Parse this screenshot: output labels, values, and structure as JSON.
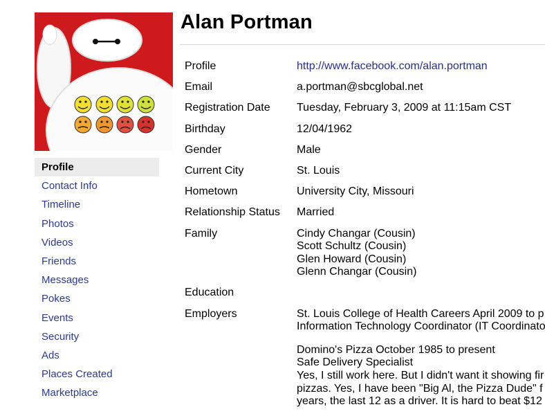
{
  "profile_name": "Alan Portman",
  "sidebar": {
    "items": [
      {
        "label": "Profile",
        "active": true
      },
      {
        "label": "Contact Info"
      },
      {
        "label": "Timeline"
      },
      {
        "label": "Photos"
      },
      {
        "label": "Videos"
      },
      {
        "label": "Friends"
      },
      {
        "label": "Messages"
      },
      {
        "label": "Pokes"
      },
      {
        "label": "Events"
      },
      {
        "label": "Security"
      },
      {
        "label": "Ads"
      },
      {
        "label": "Places Created"
      },
      {
        "label": "Marketplace"
      }
    ]
  },
  "details": {
    "profile": {
      "label": "Profile",
      "value": "http://www.facebook.com/alan.portman"
    },
    "email": {
      "label": "Email",
      "value": "a.portman@sbcglobal.net"
    },
    "registration": {
      "label": "Registration Date",
      "value": "Tuesday, February 3, 2009 at 11:15am CST"
    },
    "birthday": {
      "label": "Birthday",
      "value": "12/04/1962"
    },
    "gender": {
      "label": "Gender",
      "value": "Male"
    },
    "current_city": {
      "label": "Current City",
      "value": "St. Louis"
    },
    "hometown": {
      "label": "Hometown",
      "value": "University City, Missouri"
    },
    "relationship": {
      "label": "Relationship Status",
      "value": "Married"
    },
    "family": {
      "label": "Family",
      "members": [
        "Cindy Changar (Cousin)",
        "Scott Schultz (Cousin)",
        "Glen Howard (Cousin)",
        "Glenn Changar (Cousin)"
      ]
    },
    "education": {
      "label": "Education"
    },
    "employers": {
      "label": "Employers",
      "lines": [
        "St. Louis College of Health Careers April 2009 to p",
        "Information Technology Coordinator (IT Coordinato",
        "",
        "Domino's Pizza October 1985 to present",
        "Safe Delivery Specialist",
        "Yes, I still work here. But I didn't want it showing fir",
        "pizzas. Yes, I have been \"Big Al, the Pizza Dude\" f",
        "years, the last 12 as a driver. It is hard to beat $12"
      ]
    }
  },
  "colors": {
    "photo_background": "#cf1a1d",
    "link": "#26318c",
    "nav_link": "#2a3b8f",
    "active_nav_background": "#ececec"
  }
}
